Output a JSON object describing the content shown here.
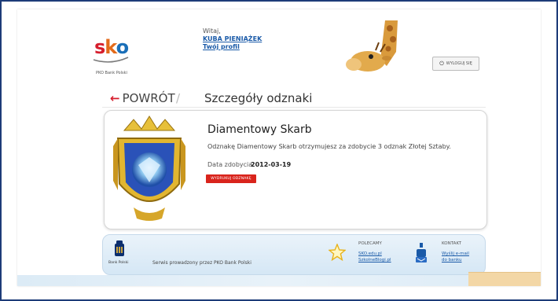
{
  "header": {
    "logo_text": [
      "s",
      "k",
      "o"
    ],
    "logo_sub": "PKO Bank Polski",
    "greeting": "Witaj,",
    "user_name": "KUBA PIENIĄŻEK",
    "profile_link": "Twój profil",
    "logout_label": "WYLOGUJ SIĘ"
  },
  "nav": {
    "back_label": "POWRÓT",
    "separator": "/",
    "page_title": "Szczegóły odznaki"
  },
  "badge": {
    "title": "Diamentowy Skarb",
    "description": "Odznakę Diamentowy Skarb otrzymujesz za zdobycie 3 odznak Złotej Sztaby.",
    "date_label": "Data zdobycia:",
    "date_value": "2012-03-19",
    "print_button": "WYDRUKUJ ODZNAKĘ"
  },
  "footer": {
    "bank_name": "Bank Polski",
    "service_text": "Serwis prowadzony przez PKO Bank Polski",
    "polecamy_heading": "POLECAMY",
    "polecamy_links": [
      "SKO.edu.pl",
      "SzkolneBlogi.pl"
    ],
    "kontakt_heading": "KONTAKT",
    "kontakt_links": [
      "Wyślij e-mail",
      "do banku"
    ]
  },
  "colors": {
    "frame_border": "#1d3c78",
    "accent_red": "#d9241c",
    "link_blue": "#1a5aa8"
  },
  "icons": {
    "back": "left-arrow-icon",
    "logout": "power-icon",
    "polecamy": "star-icon",
    "kontakt": "mailbox-icon"
  }
}
